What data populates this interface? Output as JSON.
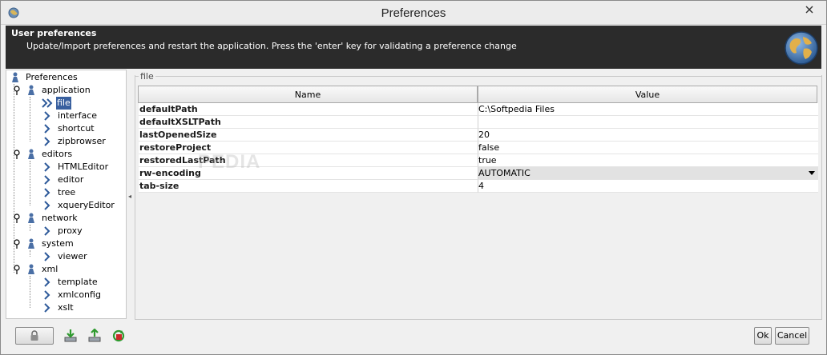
{
  "window": {
    "title": "Preferences",
    "close_icon": "close-icon",
    "app_icon": "oxygen-globe-icon"
  },
  "header": {
    "title": "User preferences",
    "description": "Update/Import preferences and restart the application. Press the 'enter' key for validating a preference change",
    "icon": "globe-icon"
  },
  "tree": {
    "root": "Preferences",
    "groups": [
      {
        "label": "application",
        "children": [
          "file",
          "interface",
          "shortcut",
          "zipbrowser"
        ]
      },
      {
        "label": "editors",
        "children": [
          "HTMLEditor",
          "editor",
          "tree",
          "xqueryEditor"
        ]
      },
      {
        "label": "network",
        "children": [
          "proxy"
        ]
      },
      {
        "label": "system",
        "children": [
          "viewer"
        ]
      },
      {
        "label": "xml",
        "children": [
          "template",
          "xmlconfig",
          "xslt"
        ]
      }
    ],
    "selected": "file"
  },
  "panel": {
    "legend": "file",
    "columns": {
      "name": "Name",
      "value": "Value"
    },
    "rows": [
      {
        "name": "defaultPath",
        "value": "C:\\Softpedia Files"
      },
      {
        "name": "defaultXSLTPath",
        "value": ""
      },
      {
        "name": "lastOpenedSize",
        "value": "20"
      },
      {
        "name": "restoreProject",
        "value": "false"
      },
      {
        "name": "restoredLastPath",
        "value": "true"
      },
      {
        "name": "rw-encoding",
        "value": "AUTOMATIC"
      },
      {
        "name": "tab-size",
        "value": "4"
      }
    ],
    "watermark": "PEDIA"
  },
  "footer": {
    "ok_label": "Ok",
    "cancel_label": "Cancel"
  },
  "colors": {
    "header_bg": "#2b2b2b",
    "selection": "#39609f"
  }
}
